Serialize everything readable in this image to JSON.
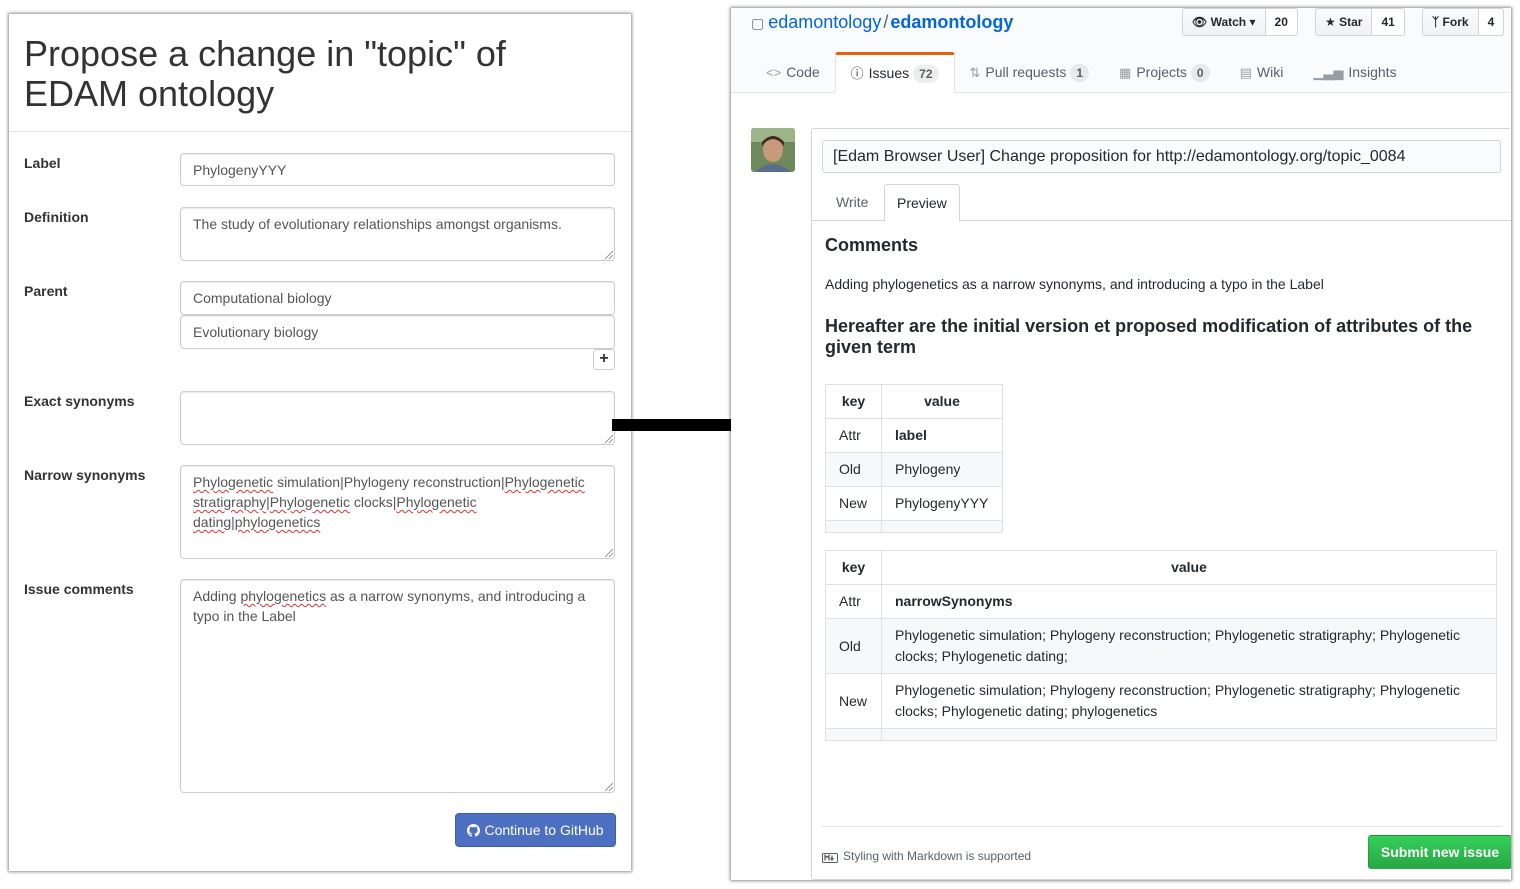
{
  "form": {
    "title": "Propose a change in \"topic\" of EDAM ontology",
    "label_label": "Label",
    "label_value": "PhylogenyYYY",
    "definition_label": "Definition",
    "definition_value": "The study of evolutionary relationships amongst organisms.",
    "parent_label": "Parent",
    "parents": [
      "Computational biology",
      "Evolutionary biology"
    ],
    "add_parent_icon": "plus-icon",
    "exact_synonyms_label": "Exact synonyms",
    "exact_synonyms_value": "",
    "narrow_synonyms_label": "Narrow synonyms",
    "narrow_synonyms_value": "Phylogenetic simulation|Phylogeny reconstruction|Phylogenetic stratigraphy|Phylogenetic clocks|Phylogenetic dating|phylogenetics",
    "issue_comments_label": "Issue comments",
    "issue_comments_value": "Adding phylogenetics as a narrow synonyms, and introducing a typo in the Label",
    "submit_label": "Continue to GitHub",
    "submit_icon": "github-icon"
  },
  "arrow": {
    "icon": "right-arrow-icon",
    "color": "#000000"
  },
  "github": {
    "owner": "edamontology",
    "separator": "/",
    "repo": "edamontology",
    "watch_label": "Watch",
    "watch_count": "20",
    "star_label": "Star",
    "star_count": "41",
    "fork_label": "Fork",
    "fork_count": "4",
    "tabs": [
      {
        "label": "Code",
        "icon": "code-icon",
        "badge": ""
      },
      {
        "label": "Issues",
        "icon": "issue-icon",
        "badge": "72"
      },
      {
        "label": "Pull requests",
        "icon": "pull-request-icon",
        "badge": "1"
      },
      {
        "label": "Projects",
        "icon": "project-icon",
        "badge": "0"
      },
      {
        "label": "Wiki",
        "icon": "book-icon",
        "badge": ""
      },
      {
        "label": "Insights",
        "icon": "graph-icon",
        "badge": ""
      }
    ],
    "active_tab": "Issues",
    "issue_title": "[Edam Browser User] Change proposition for http://edamontology.org/topic_0084",
    "write_tab": "Write",
    "preview_tab": "Preview",
    "preview": {
      "comments_heading": "Comments",
      "comments_text": "Adding phylogenetics as a narrow synonyms, and introducing a typo in the Label",
      "attributes_heading": "Hereafter are the initial version et proposed modification of attributes of the given term",
      "table1": {
        "headers": [
          "key",
          "value"
        ],
        "rows": [
          [
            "Attr",
            "label"
          ],
          [
            "Old",
            "Phylogeny"
          ],
          [
            "New",
            "PhylogenyYYY"
          ]
        ]
      },
      "table2": {
        "headers": [
          "key",
          "value"
        ],
        "rows": [
          [
            "Attr",
            "narrowSynonyms"
          ],
          [
            "Old",
            "Phylogenetic simulation; Phylogeny reconstruction; Phylogenetic stratigraphy; Phylogenetic clocks; Phylogenetic dating;"
          ],
          [
            "New",
            "Phylogenetic simulation; Phylogeny reconstruction; Phylogenetic stratigraphy; Phylogenetic clocks; Phylogenetic dating; phylogenetics"
          ]
        ]
      }
    },
    "markdown_note": "Styling with Markdown is supported",
    "submit_label": "Submit new issue",
    "colors": {
      "link": "#0366d6",
      "submit": "#28a745",
      "active_tab_border": "#e36209"
    }
  }
}
